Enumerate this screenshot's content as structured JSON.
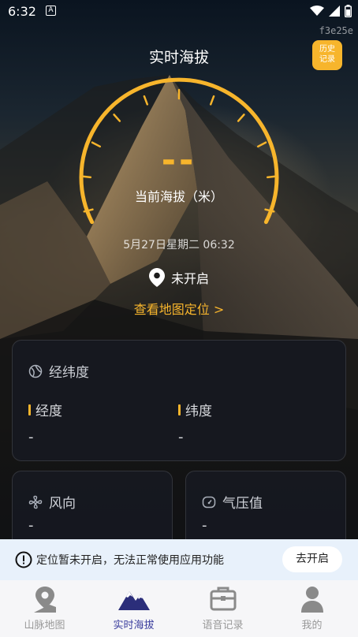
{
  "status_bar": {
    "time": "6:32",
    "a_icon": "A"
  },
  "watermark": "f3e25e",
  "header": {
    "title": "实时海拔",
    "history_button": [
      "历史",
      "记录"
    ]
  },
  "altitude": {
    "value": "--",
    "label": "当前海拔（米）",
    "datetime": "5月27日星期二 06:32"
  },
  "location": {
    "status": "未开启",
    "map_link": "查看地图定位 >"
  },
  "coords_card": {
    "title": "经纬度",
    "longitude_label": "经度",
    "longitude_value": "-",
    "latitude_label": "纬度",
    "latitude_value": "-"
  },
  "wind_card": {
    "title": "风向",
    "value": "-"
  },
  "pressure_card": {
    "title": "气压值",
    "value": "-"
  },
  "notice": {
    "text": "定位暂未开启，无法正常使用应用功能",
    "button": "去开启"
  },
  "tabs": [
    {
      "label": "山脉地图",
      "icon": "map-pin-icon",
      "active": false
    },
    {
      "label": "实时海拔",
      "icon": "mountain-icon",
      "active": true
    },
    {
      "label": "语音记录",
      "icon": "briefcase-icon",
      "active": false
    },
    {
      "label": "我的",
      "icon": "person-icon",
      "active": false
    }
  ],
  "colors": {
    "accent": "#f7b52c",
    "active_tab": "#3c3f9e",
    "notice_bg": "#e8f1fb"
  }
}
